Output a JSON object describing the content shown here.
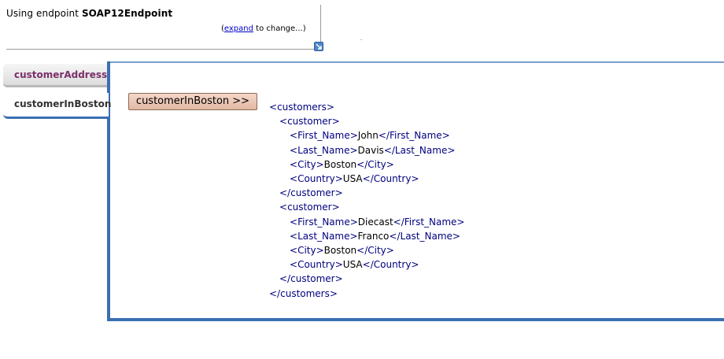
{
  "endpoint": {
    "prefix": "Using  endpoint",
    "name": "SOAP12Endpoint",
    "change_open": "(",
    "change_link": "expand",
    "change_suffix": " to  change...)"
  },
  "tabs": [
    {
      "label": "customerAddress"
    },
    {
      "label": "customerInBoston"
    }
  ],
  "operation_button": "customerInBoston >>",
  "xml": {
    "root": "customers",
    "record": "customer",
    "fields": [
      "First_Name",
      "Last_Name",
      "City",
      "Country"
    ],
    "customers": [
      {
        "First_Name": "John",
        "Last_Name": "Davis",
        "City": "Boston",
        "Country": "USA"
      },
      {
        "First_Name": "Diecast",
        "Last_Name": "Franco",
        "City": "Boston",
        "Country": "USA"
      }
    ]
  },
  "colors": {
    "accent": "#3a6fb0",
    "tag": "#000080",
    "tab_inactive_text": "#7a2f6a",
    "button_bg": "#e8c4b2"
  },
  "icons": {
    "expand": "expand-arrow-icon"
  }
}
